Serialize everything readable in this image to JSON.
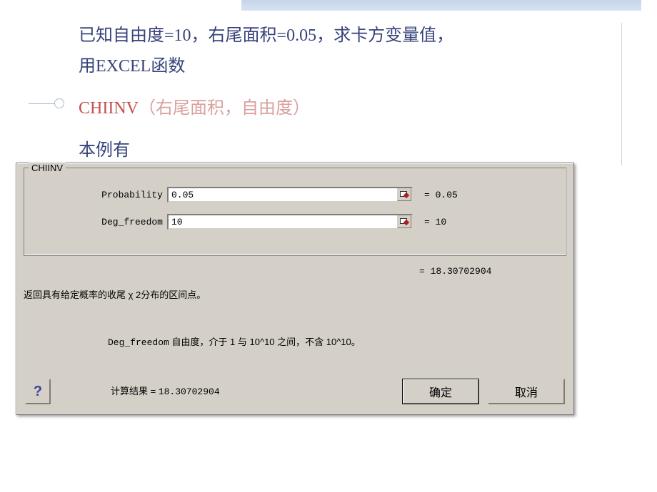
{
  "slide": {
    "line1": "已知自由度=10，右尾面积=0.05，求卡方变量值，",
    "line2": "用EXCEL函数",
    "formula_name": "CHIINV",
    "formula_args": "（右尾面积，自由度）",
    "example_label": "本例有"
  },
  "dialog": {
    "group_title": "CHIINV",
    "args": {
      "probability": {
        "label": "Probability",
        "value": "0.05",
        "eval": "= 0.05"
      },
      "deg_freedom": {
        "label": "Deg_freedom",
        "value": "10",
        "eval": "= 10"
      }
    },
    "result_eq": "= 18.30702904",
    "description": "返回具有给定概率的收尾 χ 2分布的区间点。",
    "param_help": {
      "name": "Deg_freedom",
      "text": " 自由度，介于 1 与 10^10 之间，不含 10^10。"
    },
    "calc_label": "计算结果 =  ",
    "calc_value": "18.30702904",
    "ok_label": "确定",
    "cancel_label": "取消",
    "help_icon": "?"
  }
}
